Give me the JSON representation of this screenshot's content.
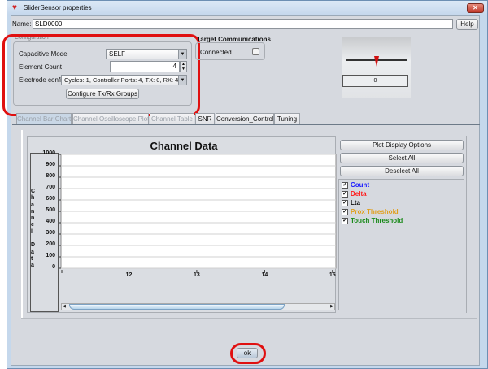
{
  "window": {
    "title": "SliderSensor properties",
    "close_icon": "close-icon",
    "app_icon": "ti-logo-icon"
  },
  "name_row": {
    "label": "Name:",
    "value": "SLD0000",
    "help_label": "Help"
  },
  "configuration": {
    "group_label": "Configuration",
    "capacitive_mode_label": "Capacitive Mode",
    "capacitive_mode_value": "SELF",
    "element_count_label": "Element Count",
    "element_count_value": "4",
    "electrode_config_label": "Electrode config",
    "electrode_config_value": "Cycles:  1, Controller Ports:  4, TX:  0, RX:  4",
    "configure_button": "Configure Tx/Rx Groups"
  },
  "target": {
    "group_label": "Target Communications",
    "connected_label": "Connected",
    "connected": false
  },
  "slider": {
    "value": "0",
    "position_fraction": 0.5
  },
  "tabs": [
    {
      "label": "Channel Bar Chart",
      "active": true
    },
    {
      "label": "Channel Oscilloscope Plot"
    },
    {
      "label": "Channel Table"
    },
    {
      "label": "SNR"
    },
    {
      "label": "Conversion_Control"
    },
    {
      "label": "Tuning"
    }
  ],
  "chart_data": {
    "type": "line",
    "title": "Channel Data",
    "ylabel": "Channel Data",
    "xlabel": "",
    "ylim": [
      0,
      1000
    ],
    "xlim": [
      11,
      15.05
    ],
    "yticks": [
      "1000",
      "900",
      "800",
      "700",
      "600",
      "500",
      "400",
      "300",
      "200",
      "100",
      "0"
    ],
    "xticks": [
      "12",
      "13",
      "14",
      "15"
    ],
    "grid": true,
    "series": []
  },
  "side_panel": {
    "plot_display_options": "Plot Display Options",
    "select_all": "Select All",
    "deselect_all": "Deselect All",
    "legend": [
      {
        "label": "Count",
        "color": "#1a1aff",
        "checked": true
      },
      {
        "label": "Delta",
        "color": "#ff1a1a",
        "checked": true
      },
      {
        "label": "Lta",
        "color": "#111111",
        "checked": true
      },
      {
        "label": "Prox Threshold",
        "color": "#e0a020",
        "checked": true
      },
      {
        "label": "Touch Threshold",
        "color": "#1a8a1a",
        "checked": true
      }
    ]
  },
  "footer": {
    "ok_label": "ok"
  },
  "colors": {
    "highlight": "#e01010"
  }
}
